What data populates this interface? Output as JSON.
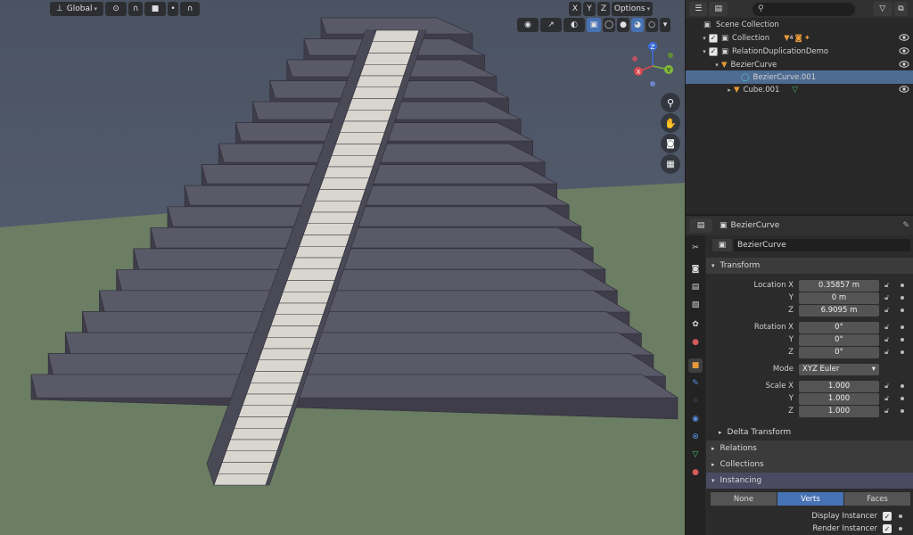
{
  "viewport": {
    "orientation_label": "Global",
    "axis_x": "X",
    "axis_y": "Y",
    "axis_z": "Z",
    "options_label": "Options",
    "gizmo_labels": {
      "x": "X",
      "y": "Y",
      "z": "Z"
    },
    "colors": {
      "sky": "#4f5a6b",
      "ground": "#6b7d63",
      "stone": "#5a5967",
      "stone_dark": "#3e3d49",
      "stairs": "#d8d6cf",
      "accent": "#4772b3"
    }
  },
  "outliner": {
    "search_placeholder": "",
    "rows": [
      {
        "label": "Scene Collection"
      },
      {
        "label": "Collection"
      },
      {
        "label": "RelationDuplicationDemo"
      },
      {
        "label": "BezierCurve"
      },
      {
        "label": "BezierCurve.001",
        "selected": true
      },
      {
        "label": "Cube.001"
      }
    ],
    "badge_count": "4"
  },
  "properties": {
    "object_name_header": "BezierCurve",
    "object_name_field": "BezierCurve",
    "transform": {
      "title": "Transform",
      "location_label": "Location X",
      "loc": [
        "0.35857 m",
        "0 m",
        "6.9095 m"
      ],
      "rotation_label": "Rotation X",
      "rot": [
        "0°",
        "0°",
        "0°"
      ],
      "y_label": "Y",
      "z_label": "Z",
      "mode_label": "Mode",
      "mode_value": "XYZ Euler",
      "scale_label": "Scale X",
      "scale": [
        "1.000",
        "1.000",
        "1.000"
      ]
    },
    "delta_transform": "Delta Transform",
    "relations": "Relations",
    "collections": "Collections",
    "instancing": {
      "title": "Instancing",
      "options": [
        "None",
        "Verts",
        "Faces"
      ],
      "selected": "Verts"
    },
    "display_instancer": "Display Instancer",
    "render_instancer": "Render Instancer"
  }
}
